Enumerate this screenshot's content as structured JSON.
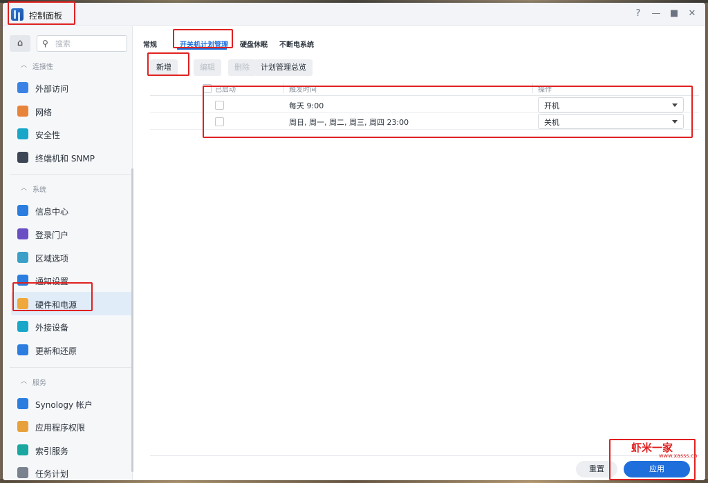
{
  "window": {
    "title": "控制面板"
  },
  "window_controls": [
    "?",
    "—",
    "■",
    "✕"
  ],
  "sidebar": {
    "search_placeholder": "搜索",
    "sections": [
      {
        "title": "连接性",
        "items": [
          {
            "label": "外部访问",
            "icon": "globe-link-icon",
            "color": "#3b82e6"
          },
          {
            "label": "网络",
            "icon": "network-house-icon",
            "color": "#e8833a"
          },
          {
            "label": "安全性",
            "icon": "shield-check-icon",
            "color": "#19a7c9"
          },
          {
            "label": "终端机和 SNMP",
            "icon": "terminal-icon",
            "color": "#3c4657"
          }
        ]
      },
      {
        "title": "系统",
        "items": [
          {
            "label": "信息中心",
            "icon": "info-icon",
            "color": "#2b7de0"
          },
          {
            "label": "登录门户",
            "icon": "login-portal-icon",
            "color": "#6a4fc4"
          },
          {
            "label": "区域选项",
            "icon": "region-map-icon",
            "color": "#3aa0c8"
          },
          {
            "label": "通知设置",
            "icon": "notification-icon",
            "color": "#2b7de0"
          },
          {
            "label": "硬件和电源",
            "icon": "lightbulb-icon",
            "color": "#f0a83a",
            "active": true
          },
          {
            "label": "外接设备",
            "icon": "external-device-icon",
            "color": "#19a7c9"
          },
          {
            "label": "更新和还原",
            "icon": "update-restore-icon",
            "color": "#2b7de0"
          }
        ]
      },
      {
        "title": "服务",
        "items": [
          {
            "label": "Synology 帐户",
            "icon": "account-icon",
            "color": "#2b7de0"
          },
          {
            "label": "应用程序权限",
            "icon": "lock-icon",
            "color": "#e8a13a"
          },
          {
            "label": "索引服务",
            "icon": "index-search-icon",
            "color": "#19a7a0"
          },
          {
            "label": "任务计划",
            "icon": "calendar-icon",
            "color": "#7a8290"
          }
        ]
      }
    ]
  },
  "tabs": [
    {
      "label": "常规"
    },
    {
      "label": "开关机计划管理",
      "active": true
    },
    {
      "label": "硬盘休眠"
    },
    {
      "label": "不断电系统"
    }
  ],
  "toolbar": {
    "add": "新增",
    "edit": "编辑",
    "delete": "删除",
    "overview": "计划管理总览"
  },
  "table": {
    "headers": {
      "enabled": "已启动",
      "trigger_time": "触发时间",
      "action": "操作"
    },
    "rows": [
      {
        "time": "每天 9:00",
        "action": "开机"
      },
      {
        "time": "周日, 周一, 周二, 周三, 周四 23:00",
        "action": "关机"
      }
    ]
  },
  "footer": {
    "reset": "重置",
    "apply": "应用"
  },
  "watermark": {
    "text": "虾米一家",
    "sub": "www.xasss.cn"
  },
  "colors": {
    "accent": "#1e6fdc",
    "annotation": "#e02020",
    "active_bg": "#e1ecf9"
  }
}
